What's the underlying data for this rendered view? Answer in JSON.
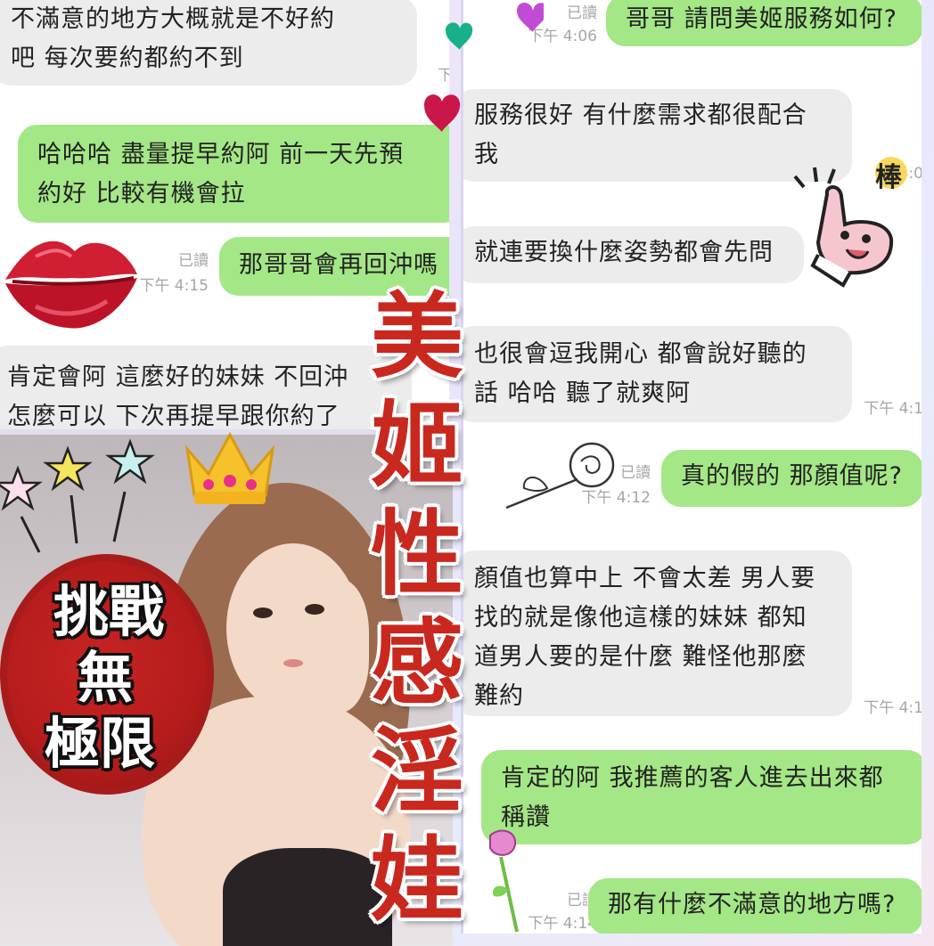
{
  "left_chat": {
    "messages": [
      {
        "id": "l1",
        "side": "recv",
        "text": "不滿意的地方大概就是不好約\n吧 每次要約都約不到"
      },
      {
        "id": "l2",
        "side": "sent",
        "text": "哈哈哈 盡量提早約阿 前一天先預\n約好 比較有機會拉"
      },
      {
        "id": "l3",
        "side": "sent",
        "text": "那哥哥會再回沖嗎",
        "read": "已讀",
        "time": "下午 4:15"
      },
      {
        "id": "l4",
        "side": "recv",
        "text": "肯定會阿 這麼好的妹妹 不回沖\n怎麼可以 下次再提早跟你約了"
      }
    ],
    "partial_meta": "下"
  },
  "right_chat": {
    "messages": [
      {
        "id": "r1",
        "side": "sent",
        "text": "哥哥 請問美姬服務如何?",
        "read": "已讀",
        "time": "下午 4:06"
      },
      {
        "id": "r2",
        "side": "recv",
        "text": "服務很好 有什麼需求都很配合\n我"
      },
      {
        "id": "r3",
        "side": "recv",
        "text": "就連要換什麼姿勢都會先問"
      },
      {
        "id": "r4",
        "side": "recv",
        "text": "也很會逗我開心 都會說好聽的\n話 哈哈 聽了就爽阿",
        "time": "下午 4:1"
      },
      {
        "id": "r5",
        "side": "sent",
        "text": "真的假的 那顏值呢?",
        "read": "已讀",
        "time": "下午 4:12"
      },
      {
        "id": "r6",
        "side": "recv",
        "text": "顏值也算中上 不會太差 男人要\n找的就是像他這樣的妹妹 都知\n道男人要的是什麼 難怪他那麼\n難約",
        "time": "下午 4:1"
      },
      {
        "id": "r7",
        "side": "sent",
        "text": "肯定的阿 我推薦的客人進去出來都\n稱讚"
      },
      {
        "id": "r8",
        "side": "sent",
        "text": "那有什麼不滿意的地方嗎?",
        "read": "已讀",
        "time": "下午 4:14"
      }
    ],
    "partial_meta": "4:0"
  },
  "overlay": {
    "title_chars": [
      "美",
      "姬",
      "性",
      "感",
      "淫",
      "娃"
    ],
    "badge_lines": [
      "挑戰",
      "無",
      "極限"
    ],
    "sticker_thumb_text": "棒"
  },
  "colors": {
    "sent_bubble": "#a4e786",
    "recv_bubble": "#ececed",
    "title_red": "#c9281f",
    "badge_red": "#b61c1c"
  }
}
